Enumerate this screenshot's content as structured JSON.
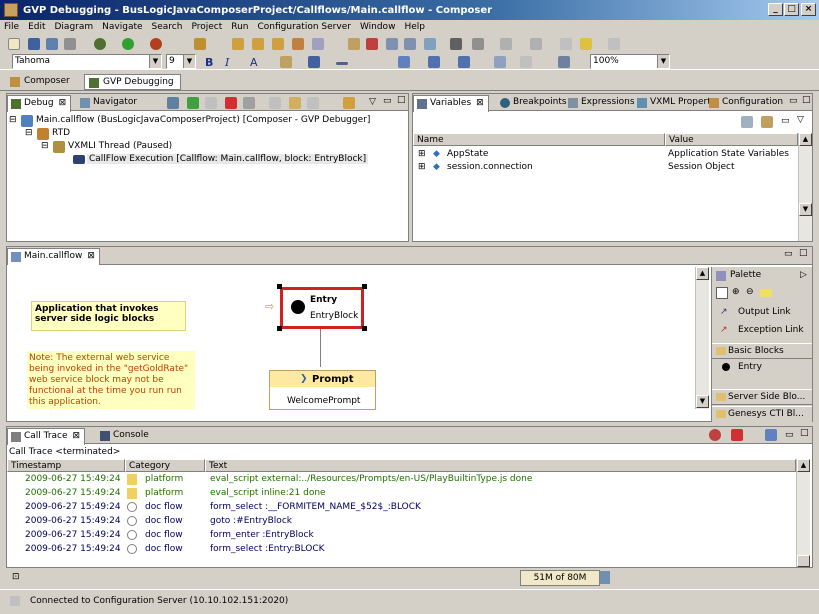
{
  "window": {
    "title": "GVP Debugging - BusLogicJavaComposerProject/Callflows/Main.callflow - Composer",
    "min": "_",
    "max": "□",
    "close": "×"
  },
  "menu": [
    "File",
    "Edit",
    "Diagram",
    "Navigate",
    "Search",
    "Project",
    "Run",
    "Configuration Server",
    "Window",
    "Help"
  ],
  "toolbar": {
    "font": "Tahoma",
    "size": "9",
    "bold": "B",
    "italic": "I",
    "font_color": "A",
    "zoom": "100%"
  },
  "perspectives": [
    {
      "label": "Composer"
    },
    {
      "label": "GVP Debugging"
    }
  ],
  "debug_view": {
    "tabs": [
      {
        "label": "Debug"
      },
      {
        "label": "Navigator"
      }
    ],
    "tree": [
      {
        "label": "Main.callflow (BusLogicJavaComposerProject) [Composer - GVP Debugger]"
      },
      {
        "label": "RTD"
      },
      {
        "label": "VXMLI Thread (Paused)"
      },
      {
        "label": "CallFlow Execution [Callflow: Main.callflow, block: EntryBlock]"
      }
    ]
  },
  "variables_view": {
    "tabs": [
      {
        "label": "Variables"
      },
      {
        "label": "Breakpoints"
      },
      {
        "label": "Expressions"
      },
      {
        "label": "VXML Propert"
      },
      {
        "label": "Configuration"
      }
    ],
    "columns": [
      "Name",
      "Value"
    ],
    "rows": [
      {
        "name": "AppState",
        "value": "Application State Variables"
      },
      {
        "name": "session.connection",
        "value": "Session Object"
      }
    ]
  },
  "editor": {
    "tab": "Main.callflow",
    "note1": "Application that invokes server side logic blocks",
    "note2": "Note: The external web service being invoked in the \"getGoldRate\" web service block may not be functional at the time you run run this application.",
    "entry_block": {
      "title": "Entry",
      "name": "EntryBlock"
    },
    "prompt_block": {
      "title": "Prompt",
      "name": "WelcomePrompt"
    },
    "palette": {
      "title": "Palette",
      "items": [
        "Output Link",
        "Exception Link"
      ],
      "drawer1": "Basic Blocks",
      "drawer1_items": [
        "Entry"
      ],
      "drawer2": "Server Side Blo...",
      "drawer3": "Genesys CTI Bl..."
    }
  },
  "calltrace": {
    "tabs": [
      {
        "label": "Call Trace"
      },
      {
        "label": "Console"
      }
    ],
    "subtitle": "Call Trace <terminated>",
    "columns": [
      "Timestamp",
      "Category",
      "Text"
    ],
    "rows": [
      {
        "ts": "2009-06-27 15:49:24",
        "cat": "platform",
        "text": "eval_script external:../Resources/Prompts/en-US/PlayBuiltinType.js done"
      },
      {
        "ts": "2009-06-27 15:49:24",
        "cat": "platform",
        "text": "eval_script inline:21 done"
      },
      {
        "ts": "2009-06-27 15:49:24",
        "cat": "doc flow",
        "text": "form_select :__FORMITEM_NAME_$52$_:BLOCK"
      },
      {
        "ts": "2009-06-27 15:49:24",
        "cat": "doc flow",
        "text": "goto :#EntryBlock"
      },
      {
        "ts": "2009-06-27 15:49:24",
        "cat": "doc flow",
        "text": "form_enter :EntryBlock"
      },
      {
        "ts": "2009-06-27 15:49:24",
        "cat": "doc flow",
        "text": "form_select :Entry:BLOCK"
      }
    ]
  },
  "status": {
    "memory": "51M of 80M",
    "message": "Connected to Configuration Server (10.10.102.151:2020)"
  }
}
